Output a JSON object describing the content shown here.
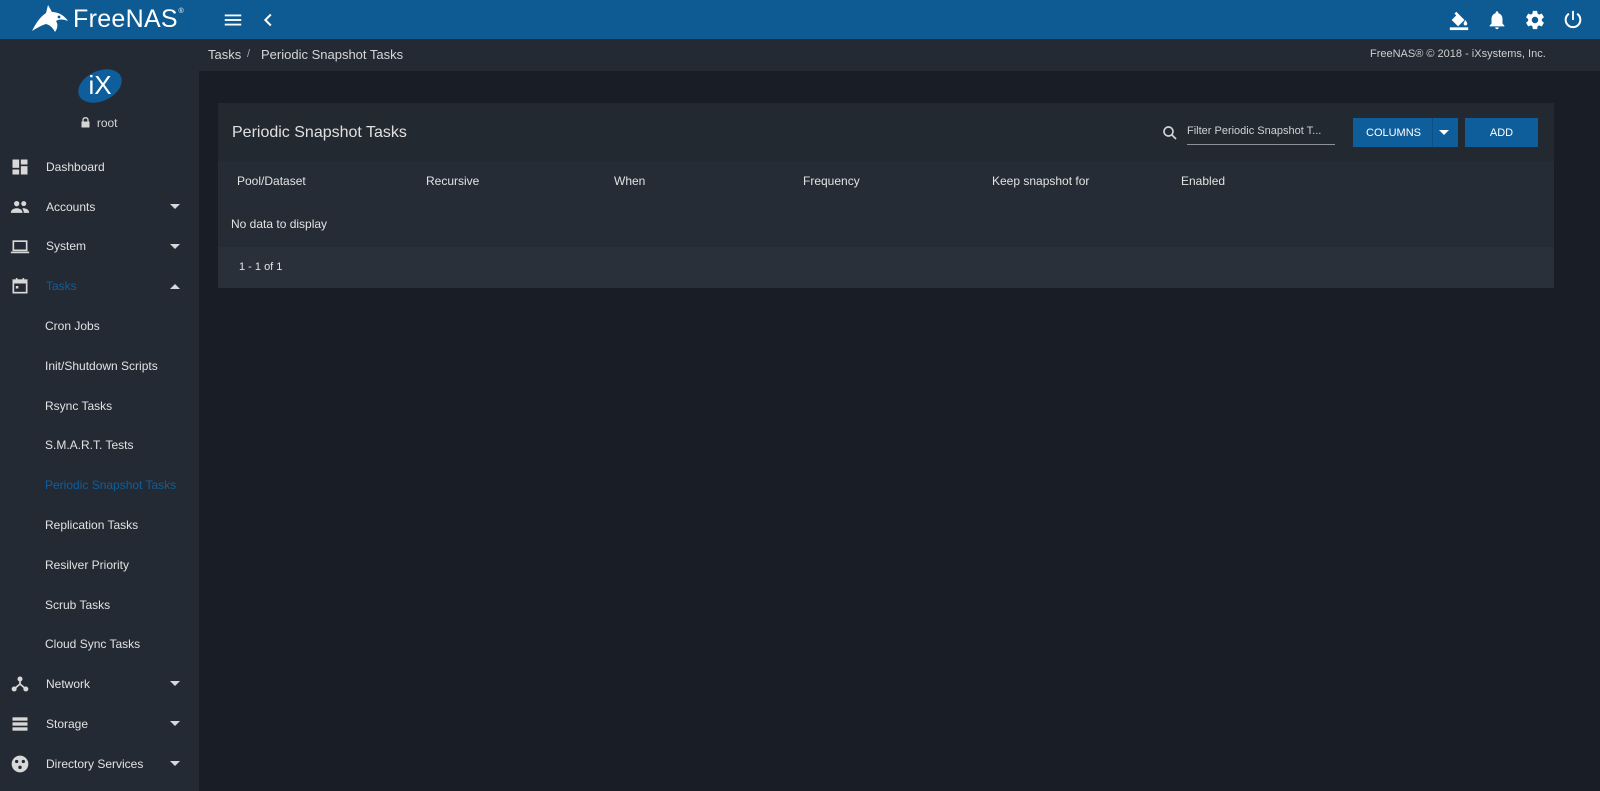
{
  "topbar": {
    "logo_text": "FreeNAS",
    "logo_tm": "®",
    "icons": [
      "menu-icon",
      "chevron-left-icon",
      "paint-bucket-icon",
      "bell-icon",
      "gear-icon",
      "power-icon"
    ]
  },
  "colors": {
    "topbar": "#0e5a93",
    "sidebar": "#242a33",
    "page": "#181d26",
    "accent": "#0f5e9c"
  },
  "user": {
    "name": "root",
    "avatar_text": "iX"
  },
  "breadcrumb": {
    "parent": "Tasks",
    "separator": "/",
    "current": "Periodic Snapshot Tasks"
  },
  "copyright": "FreeNAS® © 2018 - iXsystems, Inc.",
  "sidebar": {
    "items": [
      {
        "label": "Dashboard",
        "icon": "dashboard-icon"
      },
      {
        "label": "Accounts",
        "icon": "people-icon"
      },
      {
        "label": "System",
        "icon": "laptop-icon"
      },
      {
        "label": "Tasks",
        "icon": "calendar-icon"
      }
    ],
    "task_subitems": [
      "Cron Jobs",
      "Init/Shutdown Scripts",
      "Rsync Tasks",
      "S.M.A.R.T. Tests",
      "Periodic Snapshot Tasks",
      "Replication Tasks",
      "Resilver Priority",
      "Scrub Tasks",
      "Cloud Sync Tasks"
    ],
    "bottom_items": [
      {
        "label": "Network",
        "icon": "network-icon"
      },
      {
        "label": "Storage",
        "icon": "storage-icon"
      },
      {
        "label": "Directory Services",
        "icon": "directory-icon"
      }
    ]
  },
  "card": {
    "title": "Periodic Snapshot Tasks",
    "filter_placeholder": "Filter Periodic Snapshot T...",
    "columns_button": "COLUMNS",
    "add_button": "ADD",
    "columns": [
      "Pool/Dataset",
      "Recursive",
      "When",
      "Frequency",
      "Keep snapshot for",
      "Enabled"
    ],
    "empty_message": "No data to display",
    "pager": "1 - 1 of 1"
  }
}
